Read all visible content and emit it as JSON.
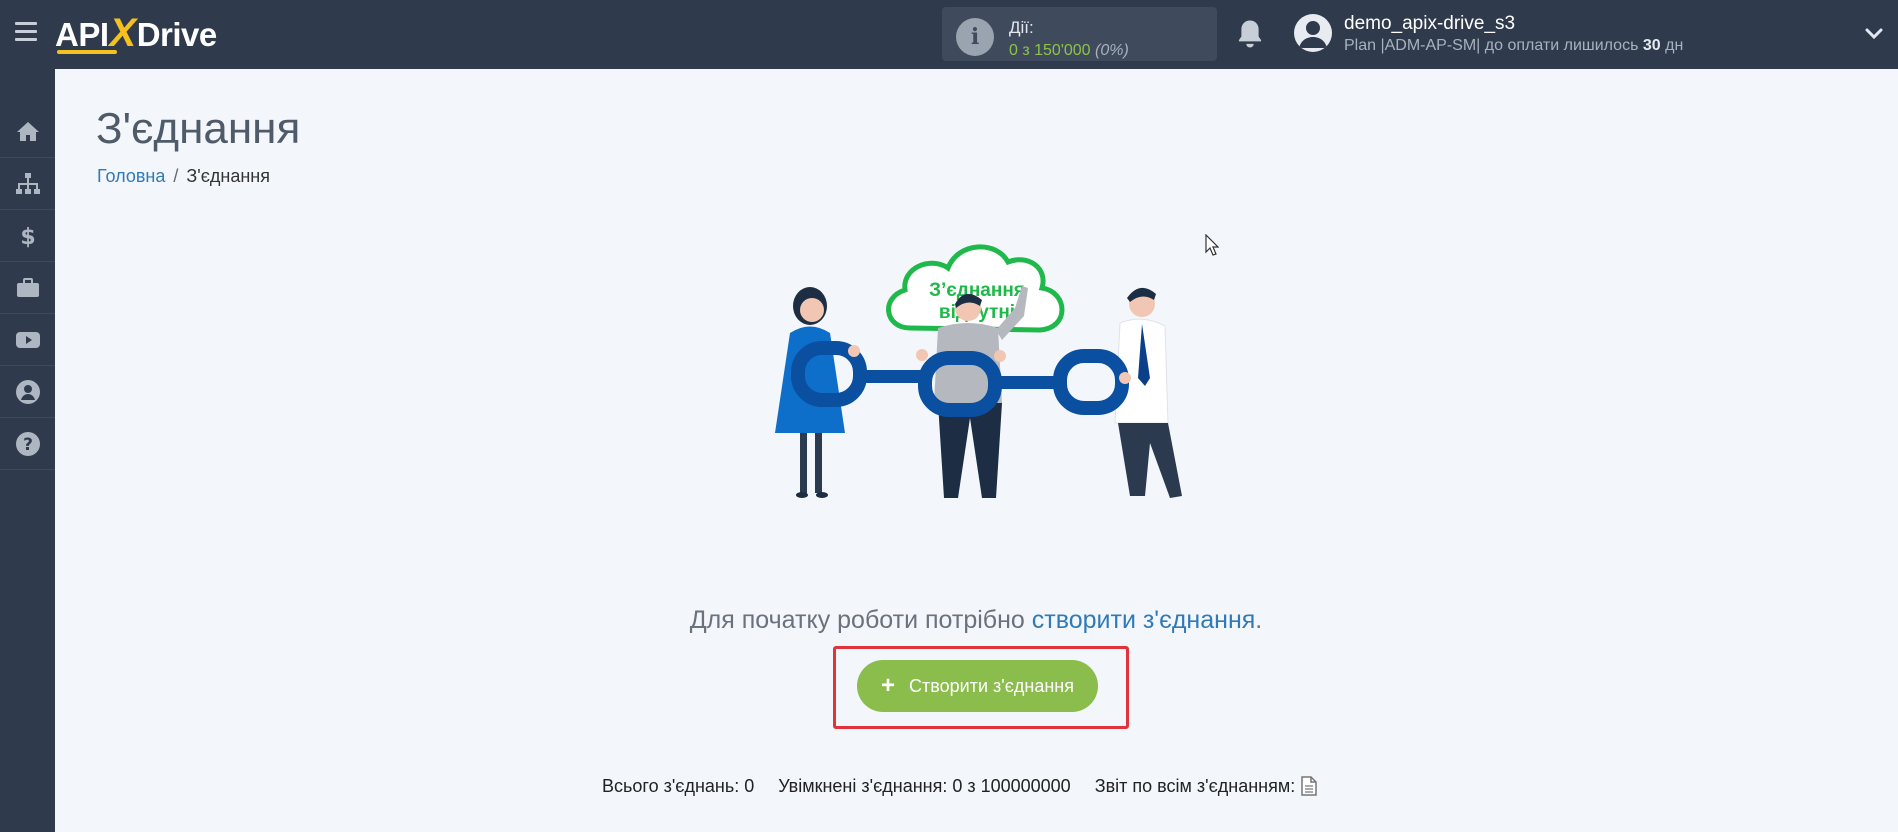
{
  "header": {
    "logo": {
      "part1": "API",
      "x": "X",
      "part2": "Drive"
    },
    "actions": {
      "label": "Дії:",
      "value": "0 з 150'000",
      "percent": "(0%)"
    },
    "user": {
      "name": "demo_apix-drive_s3",
      "plan_prefix": "Plan |ADM-AP-SM| до оплати лишилось ",
      "days": "30",
      "days_unit": " дн"
    }
  },
  "sidebar": {
    "items": [
      {
        "icon": "home-icon"
      },
      {
        "icon": "sitemap-icon"
      },
      {
        "icon": "dollar-icon"
      },
      {
        "icon": "briefcase-icon"
      },
      {
        "icon": "youtube-icon"
      },
      {
        "icon": "user-icon"
      },
      {
        "icon": "help-icon"
      }
    ]
  },
  "main": {
    "title": "З'єднання",
    "breadcrumb": {
      "home": "Головна",
      "separator": "/",
      "current": "З'єднання"
    },
    "cloud_text_line1": "З’єднання",
    "cloud_text_line2": "відсутні",
    "lead_text": "Для початку роботи потрібно ",
    "lead_link": "створити з'єднання",
    "lead_end": ".",
    "create_button": {
      "plus": "+",
      "label": "Створити з'єднання"
    },
    "stats": {
      "total": "Всього з'єднань: 0",
      "enabled": "Увімкнені з'єднання: 0 з 100000000",
      "report": "Звіт по всім з'єднанням:"
    }
  },
  "colors": {
    "topbar": "#2f3b4c",
    "accent_yellow": "#f5c11e",
    "green": "#8bbd4c",
    "link": "#2f7ab8",
    "highlight_red": "#e0333a",
    "cloud_green": "#1eb94a",
    "chain_blue": "#0b4fa0"
  }
}
